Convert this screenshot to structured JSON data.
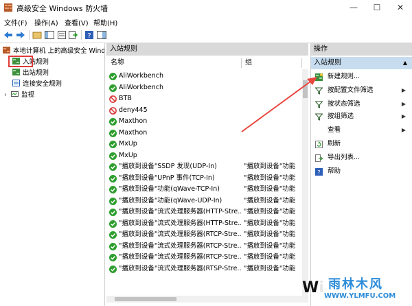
{
  "window": {
    "title": "高级安全 Windows 防火墙"
  },
  "titlebar_buttons": {
    "minimize": "—",
    "maximize": "☐",
    "close": "✕"
  },
  "menu": [
    "文件(F)",
    "操作(A)",
    "查看(V)",
    "帮助(H)"
  ],
  "tree": {
    "root": "本地计算机 上的高级安全 Windows",
    "items": [
      "入站规则",
      "出站规则",
      "连接安全规则",
      "监视"
    ]
  },
  "center": {
    "header": "入站规则",
    "columns": [
      "名称",
      "组"
    ],
    "rows": [
      {
        "name": "AliWorkbench",
        "group": "",
        "status": "allow"
      },
      {
        "name": "AliWorkbench",
        "group": "",
        "status": "allow"
      },
      {
        "name": "BTB",
        "group": "",
        "status": "block"
      },
      {
        "name": "deny445",
        "group": "",
        "status": "block"
      },
      {
        "name": "Maxthon",
        "group": "",
        "status": "allow"
      },
      {
        "name": "Maxthon",
        "group": "",
        "status": "allow"
      },
      {
        "name": "MxUp",
        "group": "",
        "status": "allow"
      },
      {
        "name": "MxUp",
        "group": "",
        "status": "allow"
      },
      {
        "name": "\"播放到设备\"SSDP 发现(UDP-In)",
        "group": "\"播放到设备\"功能",
        "status": "allow"
      },
      {
        "name": "\"播放到设备\"UPnP 事件(TCP-In)",
        "group": "\"播放到设备\"功能",
        "status": "allow"
      },
      {
        "name": "\"播放到设备\"功能(qWave-TCP-In)",
        "group": "\"播放到设备\"功能",
        "status": "allow"
      },
      {
        "name": "\"播放到设备\"功能(qWave-UDP-In)",
        "group": "\"播放到设备\"功能",
        "status": "allow"
      },
      {
        "name": "\"播放到设备\"流式处理服务器(HTTP-Stre...",
        "group": "\"播放到设备\"功能",
        "status": "allow"
      },
      {
        "name": "\"播放到设备\"流式处理服务器(HTTP-Stre...",
        "group": "\"播放到设备\"功能",
        "status": "allow"
      },
      {
        "name": "\"播放到设备\"流式处理服务器(RTCP-Stre...",
        "group": "\"播放到设备\"功能",
        "status": "allow"
      },
      {
        "name": "\"播放到设备\"流式处理服务器(RTCP-Stre...",
        "group": "\"播放到设备\"功能",
        "status": "allow"
      },
      {
        "name": "\"播放到设备\"流式处理服务器(RTCP-Stre...",
        "group": "\"播放到设备\"功能",
        "status": "allow"
      },
      {
        "name": "\"播放到设备\"流式处理服务器(RTSP-Stre...",
        "group": "\"播放到设备\"功能",
        "status": "allow"
      }
    ]
  },
  "actions": {
    "header": "操作",
    "subheader": "入站规则",
    "collapse_glyph": "▲",
    "submenu_glyph": "▶",
    "items": [
      {
        "label": "新建规则...",
        "icon": "new-rule-icon",
        "submenu": false
      },
      {
        "label": "按配置文件筛选",
        "icon": "filter-icon",
        "submenu": true
      },
      {
        "label": "按状态筛选",
        "icon": "filter-icon",
        "submenu": true
      },
      {
        "label": "按组筛选",
        "icon": "filter-icon",
        "submenu": true
      },
      {
        "label": "查看",
        "icon": "",
        "submenu": true
      },
      {
        "label": "刷新",
        "icon": "refresh-icon",
        "submenu": false
      },
      {
        "label": "导出列表...",
        "icon": "export-icon",
        "submenu": false
      },
      {
        "label": "帮助",
        "icon": "help-icon",
        "submenu": false
      }
    ]
  },
  "watermark": {
    "logo": "Wi",
    "text": "雨林木风",
    "url": "WWW.YLMFU.COM"
  },
  "colors": {
    "allow": "#2e9e2e",
    "block": "#d93a3a",
    "highlight_box": "#e03b3b",
    "arrow": "#e8473f",
    "selected_action": "#c7dcef",
    "pane_header": "#d9d9d9"
  }
}
